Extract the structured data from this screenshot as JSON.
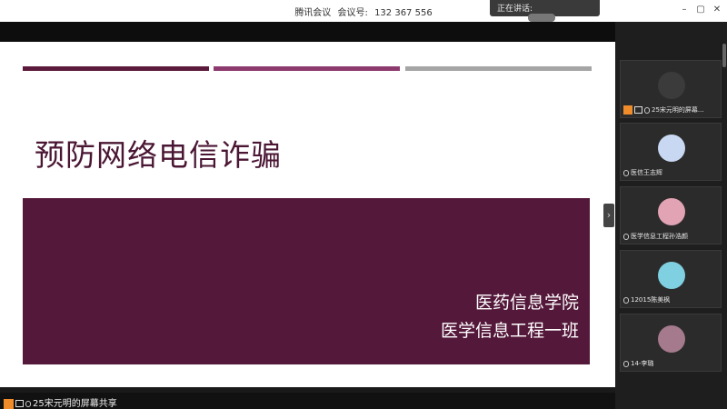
{
  "titlebar": {
    "app_name": "腾讯会议",
    "meeting_label": "会议号:",
    "meeting_id": "132 367 556",
    "speaking_label": "正在讲话:",
    "minimize": "–",
    "restore": "▢",
    "close": "✕"
  },
  "slide": {
    "title": "预防网络电信诈骗",
    "subtitle_line1": "医药信息学院",
    "subtitle_line2": "医学信息工程一班",
    "colors": {
      "bar1": "#5b1a3b",
      "bar2": "#8d3a6e",
      "bar3": "#a5a5a5",
      "panel": "#54183a",
      "title": "#4a1633"
    }
  },
  "side_toggle": {
    "icon": "chevron-right-icon",
    "glyph": "›"
  },
  "participants": [
    {
      "name": "25宋元明的屏幕...",
      "avatar_color": "#3b3b3b"
    },
    {
      "name": "医信王志辉",
      "avatar_color": "#c9d8f2"
    },
    {
      "name": "医学信息工程孙浩颜",
      "avatar_color": "#e2a3b4"
    },
    {
      "name": "12015陈美枫",
      "avatar_color": "#7fd0e0"
    },
    {
      "name": "14-李璐",
      "avatar_color": "#a57a8c"
    }
  ],
  "bottom_bar": {
    "label": "25宋元明的屏幕共享"
  }
}
